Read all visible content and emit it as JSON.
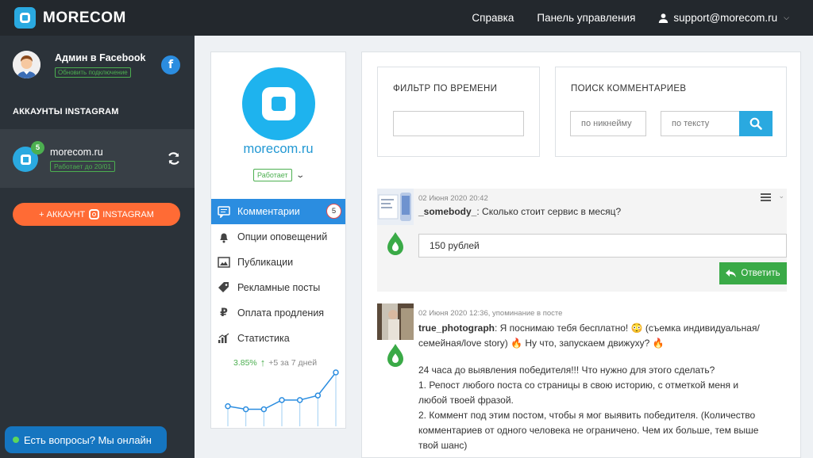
{
  "topbar": {
    "logo_text": "MORECOM",
    "nav": [
      "Справка",
      "Панель управления"
    ],
    "user_email": "support@morecom.ru"
  },
  "sidebar": {
    "fb_account": {
      "name": "Админ в Facebook",
      "badge": "Обновить подключение",
      "icon": "facebook-icon"
    },
    "section_title": "АККАУНТЫ INSTAGRAM",
    "account": {
      "name": "morecom.ru",
      "badge": "Работает до 20/01",
      "count": "5"
    },
    "add_button": {
      "prefix": "+ АККАУНТ",
      "suffix": "INSTAGRAM"
    },
    "chat_button": "Есть вопросы? Мы онлайн"
  },
  "profile": {
    "name": "morecom.ru",
    "status": "Работает",
    "menu": [
      {
        "label": "Комментарии",
        "icon": "comment-icon",
        "count": "5",
        "active": true
      },
      {
        "label": "Опции оповещений",
        "icon": "bell-icon"
      },
      {
        "label": "Публикации",
        "icon": "image-icon"
      },
      {
        "label": "Рекламные посты",
        "icon": "tag-icon"
      },
      {
        "label": "Оплата продления",
        "icon": "ruble-icon"
      },
      {
        "label": "Статистика",
        "icon": "chart-icon"
      }
    ],
    "stats": {
      "percent": "3.85%",
      "delta": "+5 за 7 дней",
      "sparkline": [
        10,
        8,
        8,
        14,
        14,
        17,
        32
      ]
    }
  },
  "filters": {
    "time_title": "ФИЛЬТР ПО ВРЕМЕНИ",
    "time_value": "",
    "search_title": "ПОИСК КОММЕНТАРИЕВ",
    "nick_placeholder": "по никнейму",
    "text_placeholder": "по тексту"
  },
  "comments": [
    {
      "date": "02 Июня 2020 20:42",
      "author": "_somebody_",
      "text": ": Сколько стоит сервис в месяц?",
      "reply": "150 рублей",
      "reply_button": "Ответить"
    },
    {
      "date": "02 Июня 2020 12:36,",
      "mention": "упоминание в посте",
      "author": "true_photograph",
      "line1": ": Я поснимаю тебя бесплатно! 😳 (съемка индивидуальная/ семейная/love story) 🔥 Ну что, запускаем движуху? 🔥",
      "line2": "24 часа до выявления победителя!!! Что нужно для этого сделать?",
      "line3": "1. Репост любого поста со страницы в свою историю, с отметкой меня и любой твоей фразой.",
      "line4": "2. Коммент под этим постом, чтобы я мог выявить победителя. (Количество комментариев от одного человека не ограничено. Чем их больше, тем выше твой шанс)"
    }
  ],
  "colors": {
    "accent": "#2b8de0",
    "brand": "#1eb3ee",
    "green": "#4caf50",
    "orange": "#ff6b35",
    "topbar": "#23282d"
  }
}
